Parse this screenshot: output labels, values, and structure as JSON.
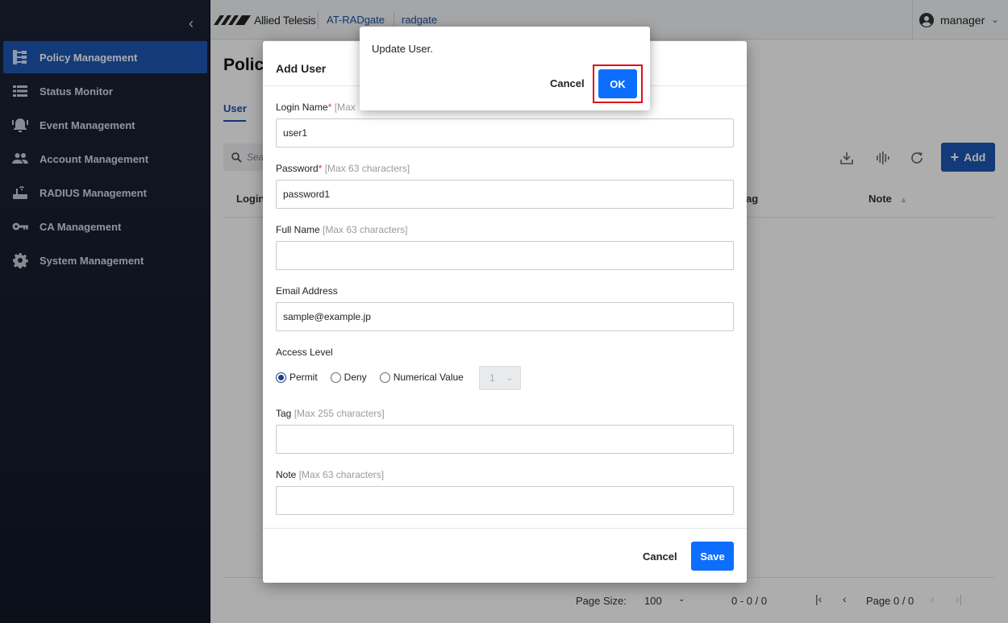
{
  "sidebar": {
    "collapse_icon": "chevron-left-icon",
    "items": [
      {
        "label": "Policy Management",
        "icon": "policy-tree-icon",
        "active": true
      },
      {
        "label": "Status Monitor",
        "icon": "list-icon",
        "active": false
      },
      {
        "label": "Event Management",
        "icon": "alarm-bell-icon",
        "active": false
      },
      {
        "label": "Account Management",
        "icon": "people-icon",
        "active": false
      },
      {
        "label": "RADIUS Management",
        "icon": "router-icon",
        "active": false
      },
      {
        "label": "CA Management",
        "icon": "key-icon",
        "active": false
      },
      {
        "label": "System Management",
        "icon": "gear-icon",
        "active": false
      }
    ]
  },
  "header": {
    "brand": "Allied Telesis",
    "product": "AT-RADgate",
    "host": "radgate",
    "user": "manager"
  },
  "main": {
    "title": "Polic",
    "tab": "User",
    "search_placeholder": "Sea",
    "add_label": "Add",
    "columns": {
      "first": "Login",
      "tag": "ag",
      "note": "Note"
    },
    "footer": {
      "page_size_label": "Page Size:",
      "page_size": "100",
      "range": "0 - 0 / 0",
      "page": "Page 0 / 0"
    }
  },
  "dialog": {
    "title": "Add User",
    "login": {
      "label": "Login Name",
      "req": "*",
      "hint": "[Max",
      "value": "user1"
    },
    "password": {
      "label": "Password",
      "req": "*",
      "hint": "[Max 63 characters]",
      "value": "password1"
    },
    "fullname": {
      "label": "Full Name",
      "hint": "[Max 63 characters]",
      "value": ""
    },
    "email": {
      "label": "Email Address",
      "value": "sample@example.jp"
    },
    "access": {
      "label": "Access Level",
      "options": [
        "Permit",
        "Deny",
        "Numerical Value"
      ],
      "selected": "Permit",
      "numeric_value": "1"
    },
    "tag": {
      "label": "Tag",
      "hint": "[Max 255 characters]",
      "value": ""
    },
    "note": {
      "label": "Note",
      "hint": "[Max 63 characters]",
      "value": ""
    },
    "cancel": "Cancel",
    "save": "Save"
  },
  "confirm": {
    "message": "Update User.",
    "cancel": "Cancel",
    "ok": "OK"
  },
  "colors": {
    "sidebar_bg": "#1b2235",
    "active_nav": "#1d58b4",
    "primary_button": "#0d6efd",
    "highlight": "#e0101a"
  }
}
